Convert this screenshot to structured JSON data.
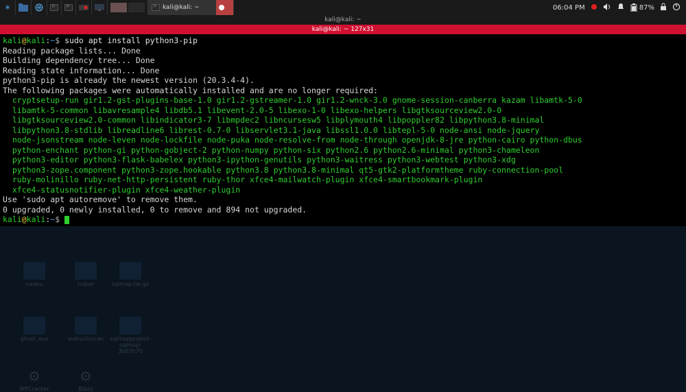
{
  "panel": {
    "taskbar_app_label": "kali@kali: ~",
    "clock": "06:04 PM",
    "battery_pct": "87%"
  },
  "desktop": {
    "icons": [
      {
        "name": "naabu"
      },
      {
        "name": "tulpar"
      },
      {
        "name": "sqlmap.tar.gz"
      },
      {
        "name": "ghost_eye"
      },
      {
        "name": "webvulnscan"
      },
      {
        "name": "sqlmapproject-sqlmap-3b07b70"
      },
      {
        "name": "WPCracker"
      },
      {
        "name": "Blazy"
      }
    ]
  },
  "terminal": {
    "outer_title": "kali@kali: ~",
    "inner_title": "kali@kali: ~ 127x31",
    "prompt_user": "kali",
    "prompt_host": "kali",
    "prompt_path": "~",
    "prompt_symbol": "$",
    "command": "sudo apt install python3-pip",
    "lines": [
      {
        "c": "white",
        "t": "Reading package lists... Done"
      },
      {
        "c": "white",
        "t": "Building dependency tree... Done"
      },
      {
        "c": "white",
        "t": "Reading state information... Done"
      },
      {
        "c": "white",
        "t": "python3-pip is already the newest version (20.3.4-4)."
      },
      {
        "c": "white",
        "t": "The following packages were automatically installed and are no longer required:"
      },
      {
        "c": "green",
        "t": "  cryptsetup-run gir1.2-gst-plugins-base-1.0 gir1.2-gstreamer-1.0 gir1.2-wnck-3.0 gnome-session-canberra kazam libamtk-5-0"
      },
      {
        "c": "green",
        "t": "  libamtk-5-common libavresample4 libdb5.1 libevent-2.0-5 libexo-1-0 libexo-helpers libgtksourceview2.0-0"
      },
      {
        "c": "green",
        "t": "  libgtksourceview2.0-common libindicator3-7 libmpdec2 libncursesw5 libplymouth4 libpoppler82 libpython3.8-minimal"
      },
      {
        "c": "green",
        "t": "  libpython3.8-stdlib libreadline6 librest-0.7-0 libservlet3.1-java libssl1.0.0 libtepl-5-0 node-ansi node-jquery"
      },
      {
        "c": "green",
        "t": "  node-jsonstream node-leven node-lockfile node-puka node-resolve-from node-through openjdk-8-jre python-cairo python-dbus"
      },
      {
        "c": "green",
        "t": "  python-enchant python-gi python-gobject-2 python-numpy python-six python2.6 python2.6-minimal python3-chameleon"
      },
      {
        "c": "green",
        "t": "  python3-editor python3-flask-babelex python3-ipython-genutils python3-waitress python3-webtest python3-xdg"
      },
      {
        "c": "green",
        "t": "  python3-zope.component python3-zope.hookable python3.8 python3.8-minimal qt5-gtk2-platformtheme ruby-connection-pool"
      },
      {
        "c": "green",
        "t": "  ruby-molinillo ruby-net-http-persistent ruby-thor xfce4-mailwatch-plugin xfce4-smartbookmark-plugin"
      },
      {
        "c": "green",
        "t": "  xfce4-statusnotifier-plugin xfce4-weather-plugin"
      },
      {
        "c": "white",
        "t": "Use 'sudo apt autoremove' to remove them."
      },
      {
        "c": "white",
        "t": "0 upgraded, 0 newly installed, 0 to remove and 894 not upgraded."
      }
    ]
  }
}
